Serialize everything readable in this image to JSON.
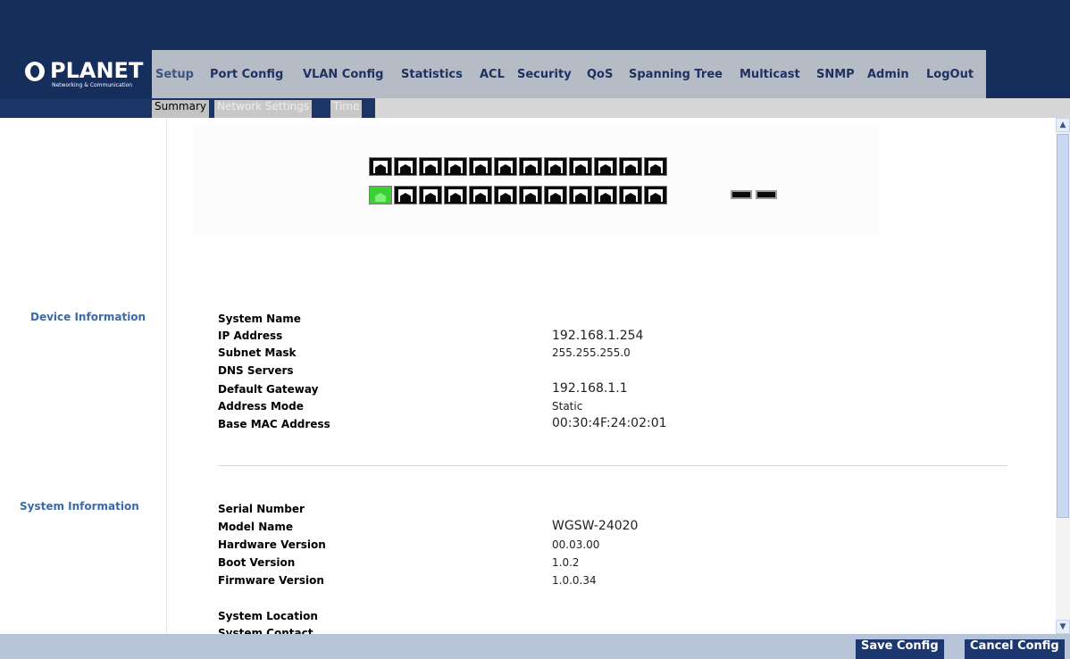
{
  "brand": {
    "name": "PLANET",
    "tagline": "Networking & Communication"
  },
  "menu": [
    {
      "label": "Setup",
      "active": true
    },
    {
      "label": "Port Config"
    },
    {
      "label": "VLAN Config"
    },
    {
      "label": "Statistics"
    },
    {
      "label": "ACL"
    },
    {
      "label": "Security"
    },
    {
      "label": "QoS"
    },
    {
      "label": "Spanning Tree"
    },
    {
      "label": "Multicast"
    },
    {
      "label": "SNMP"
    },
    {
      "label": "Admin"
    },
    {
      "label": "LogOut"
    }
  ],
  "subnav": [
    {
      "label": "Summary",
      "active": true
    },
    {
      "label": "Network Settings"
    },
    {
      "label": "Time"
    }
  ],
  "ports": {
    "top_row_count": 12,
    "bottom_row_count": 12,
    "sfp_count": 2,
    "link_up": [
      "bottom-1"
    ]
  },
  "device_info": {
    "title": "Device Information",
    "fields": [
      {
        "label": "System Name",
        "value": ""
      },
      {
        "label": "IP Address",
        "value": "192.168.1.254"
      },
      {
        "label": "Subnet Mask",
        "value": "255.255.255.0"
      },
      {
        "label": "DNS Servers",
        "value": ""
      },
      {
        "label": "Default Gateway",
        "value": "192.168.1.1"
      },
      {
        "label": "Address Mode",
        "value": "Static"
      },
      {
        "label": "Base MAC Address",
        "value": "00:30:4F:24:02:01"
      }
    ]
  },
  "system_info": {
    "title": "System Information",
    "fields": [
      {
        "label": "Serial Number",
        "value": ""
      },
      {
        "label": "Model Name",
        "value": "WGSW-24020"
      },
      {
        "label": "Hardware Version",
        "value": "00.03.00"
      },
      {
        "label": "Boot Version",
        "value": "1.0.2"
      },
      {
        "label": "Firmware Version",
        "value": "1.0.0.34"
      },
      {
        "label": "System Location",
        "value": ""
      },
      {
        "label": "System Contact",
        "value": ""
      }
    ]
  },
  "footer": {
    "save_label": "Save Config",
    "cancel_label": "Cancel Config"
  },
  "colors": {
    "header_bg": "#162e5c",
    "menubar_bg": "#b6bcc6",
    "section_title": "#3a6aa8",
    "port_up": "#3ad132",
    "footer_bg": "#b7c4d7",
    "button_bg": "#1d3870"
  }
}
